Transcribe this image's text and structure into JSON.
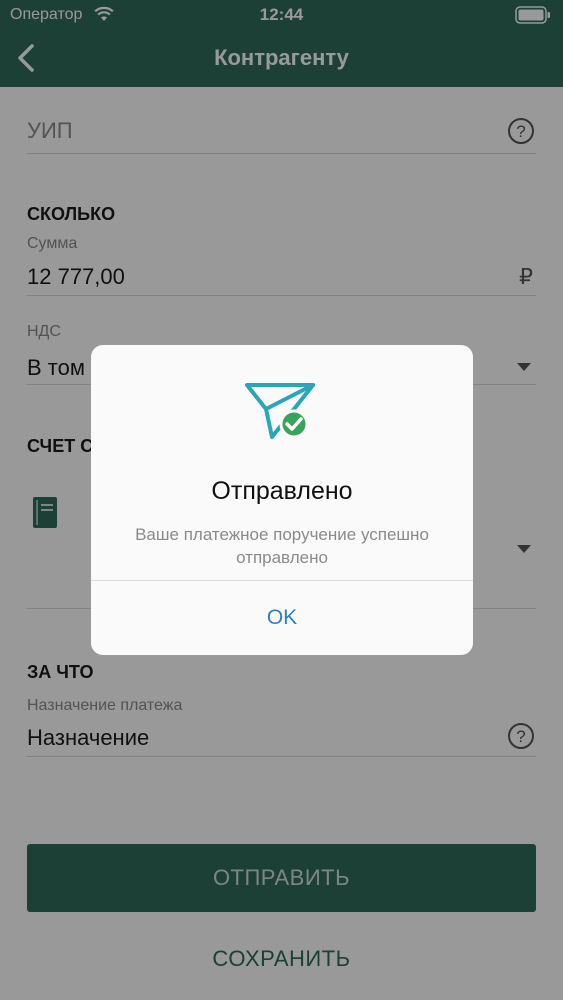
{
  "status_bar": {
    "carrier": "Оператор",
    "time": "12:44"
  },
  "nav": {
    "title": "Контрагенту"
  },
  "form": {
    "uip_placeholder": "УИП",
    "help_symbol": "?",
    "section_how_much": "СКОЛЬКО",
    "amount_label": "Сумма",
    "amount_value": "12 777,00",
    "currency_symbol": "₽",
    "vat_label": "НДС",
    "vat_value_partial": "В том",
    "section_account_partial": "СЧЕТ С",
    "section_for_what": "ЗА ЧТО",
    "purpose_label": "Назначение платежа",
    "purpose_value": "Назначение"
  },
  "buttons": {
    "send": "ОТПРАВИТЬ",
    "save": "СОХРАНИТЬ"
  },
  "dialog": {
    "title": "Отправлено",
    "message": "Ваше платежное поручение успешно отправлено",
    "ok": "OK"
  },
  "colors": {
    "brand": "#2f6b5b",
    "accent": "#2c7fce",
    "success": "#3aa35a",
    "icon_teal": "#2aa6b8"
  }
}
